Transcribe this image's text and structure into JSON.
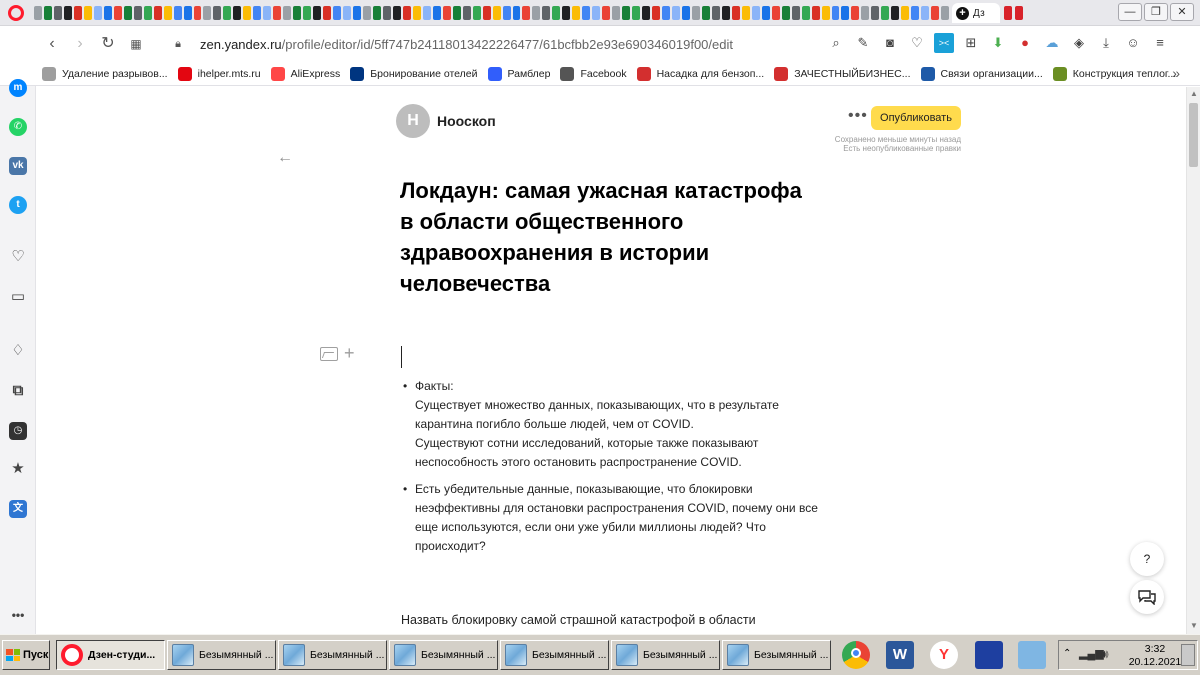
{
  "browser": {
    "active_tab_label": "Дз",
    "url_host": "zen.yandex.ru",
    "url_path": "/profile/editor/id/5ff747b24118013422226477/61bcfbb2e93e690346019f00/edit",
    "bookmarks": [
      {
        "label": "Удаление разрывов...",
        "icon": "page-icon",
        "color": "#9e9e9e"
      },
      {
        "label": "ihelper.mts.ru",
        "icon": "mts-icon",
        "color": "#e30611"
      },
      {
        "label": "AliExpress",
        "icon": "aliexpress-icon",
        "color": "#ff4747"
      },
      {
        "label": "Бронирование отелей",
        "icon": "booking-icon",
        "color": "#003580"
      },
      {
        "label": "Рамблер",
        "icon": "rambler-icon",
        "color": "#315efb"
      },
      {
        "label": "Facebook",
        "icon": "page-icon",
        "color": "#555555"
      },
      {
        "label": "Насадка для бензоп...",
        "icon": "site-icon",
        "color": "#d32f2f"
      },
      {
        "label": "ЗАЧЕСТНЫЙБИЗНЕС...",
        "icon": "za-icon",
        "color": "#d32f2f"
      },
      {
        "label": "Связи организации...",
        "icon": "list-org-icon",
        "color": "#1e5aa8"
      },
      {
        "label": "Конструкция теплог...",
        "icon": "site-icon",
        "color": "#6b8e23"
      }
    ]
  },
  "editor": {
    "author_initial": "Н",
    "author_name": "Нооскоп",
    "more_label": "•••",
    "publish_label": "Опубликовать",
    "save_status_line1": "Сохранено меньше минуты назад",
    "save_status_line2": "Есть неопубликованные правки",
    "title": "Локдаун: самая ужасная катастрофа в области общественного здравоохранения в истории человечества",
    "bullets": [
      {
        "lines": [
          "Факты:",
          "Существует множество данных, показывающих, что в результате карантина погибло больше людей, чем от COVID.",
          "Существуют сотни исследований, которые также показывают неспособность этого остановить распространение COVID."
        ]
      },
      {
        "lines": [
          "Есть убедительные данные, показывающие, что блокировки неэффективны для остановки распространения COVID,  почему они все еще используются, если они уже убили миллионы людей? Что происходит?"
        ]
      }
    ],
    "bottom_text": "Назвать блокировку самой страшной катастрофой в области",
    "help_label": "?"
  },
  "taskbar": {
    "start_label": "Пуск",
    "tasks": [
      {
        "label": "Дзен-студи...",
        "icon": "opera-icon",
        "active": true
      },
      {
        "label": "Безымянный ...",
        "icon": "paint-icon",
        "active": false
      },
      {
        "label": "Безымянный ...",
        "icon": "paint-icon",
        "active": false
      },
      {
        "label": "Безымянный ...",
        "icon": "paint-icon",
        "active": false
      },
      {
        "label": "Безымянный ...",
        "icon": "paint-icon",
        "active": false
      },
      {
        "label": "Безымянный ...",
        "icon": "paint-icon",
        "active": false
      },
      {
        "label": "Безымянный ...",
        "icon": "paint-icon",
        "active": false
      }
    ],
    "quick_launch": [
      {
        "icon": "chrome-icon",
        "glyph": "",
        "color": "#4caf50"
      },
      {
        "icon": "word-icon",
        "glyph": "W",
        "color": "#2b579a"
      },
      {
        "icon": "yandex-browser-icon",
        "glyph": "Y",
        "color": "#ff3333"
      },
      {
        "icon": "save-disk-icon",
        "glyph": "",
        "color": "#1e3fa0"
      },
      {
        "icon": "paint-icon",
        "glyph": "",
        "color": "#7fb6e3"
      }
    ],
    "time": "3:32",
    "date": "20.12.2021"
  }
}
